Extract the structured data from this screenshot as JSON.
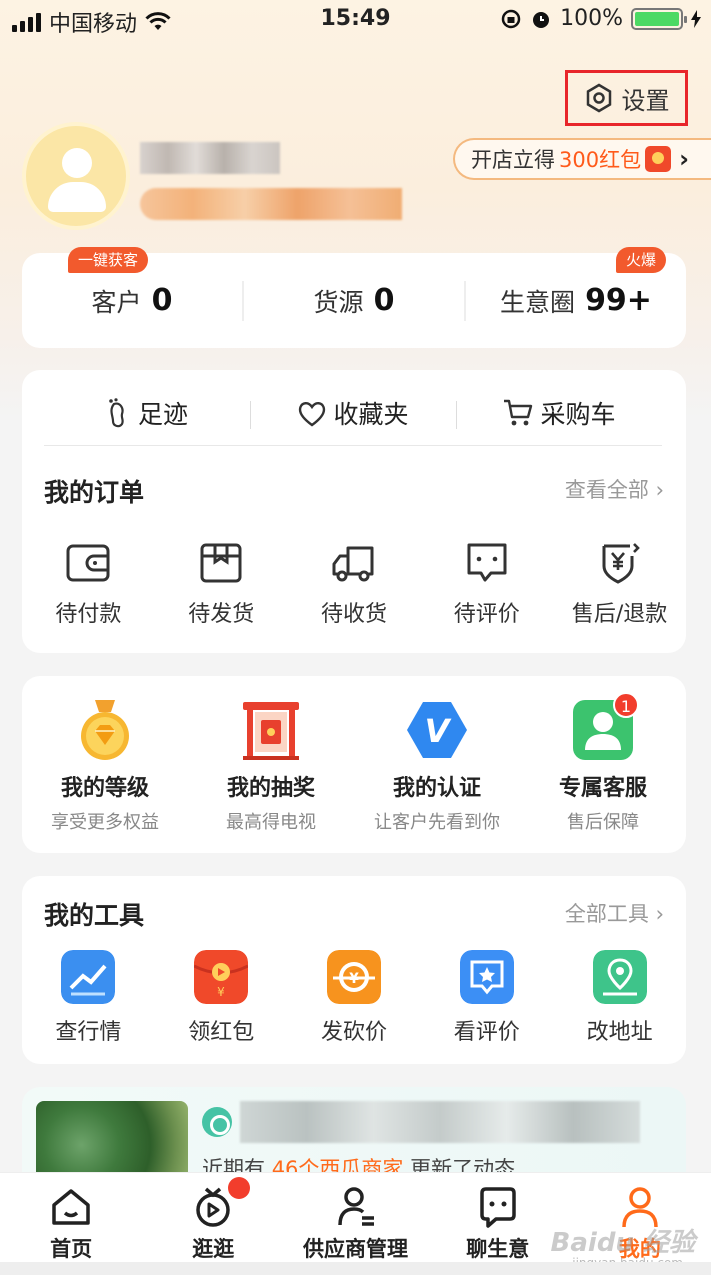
{
  "status_bar": {
    "carrier": "中国移动",
    "time": "15:49",
    "battery": "100%"
  },
  "header": {
    "settings_label": "设置",
    "promo": {
      "prefix": "开店立得",
      "amount": "300红包"
    }
  },
  "stats": [
    {
      "label": "客户",
      "value": "0",
      "tag": "一键获客"
    },
    {
      "label": "货源",
      "value": "0",
      "tag": ""
    },
    {
      "label": "生意圈",
      "value": "99+",
      "tag": "火爆"
    }
  ],
  "quick_links": [
    {
      "label": "足迹",
      "icon": "footprint-icon"
    },
    {
      "label": "收藏夹",
      "icon": "heart-icon"
    },
    {
      "label": "采购车",
      "icon": "cart-icon"
    }
  ],
  "orders": {
    "title": "我的订单",
    "more": "查看全部",
    "items": [
      {
        "label": "待付款",
        "icon": "wallet-icon"
      },
      {
        "label": "待发货",
        "icon": "package-icon"
      },
      {
        "label": "待收货",
        "icon": "truck-icon"
      },
      {
        "label": "待评价",
        "icon": "chat-icon"
      },
      {
        "label": "售后/退款",
        "icon": "refund-icon"
      }
    ]
  },
  "services": [
    {
      "title": "我的等级",
      "subtitle": "享受更多权益",
      "icon": "medal-icon"
    },
    {
      "title": "我的抽奖",
      "subtitle": "最高得电视",
      "icon": "lottery-icon"
    },
    {
      "title": "我的认证",
      "subtitle": "让客户先看到你",
      "icon": "verified-icon"
    },
    {
      "title": "专属客服",
      "subtitle": "售后保障",
      "icon": "service-icon",
      "badge": "1"
    }
  ],
  "tools": {
    "title": "我的工具",
    "more": "全部工具",
    "items": [
      {
        "label": "查行情",
        "icon": "trend-icon",
        "color": "#3b8ff0"
      },
      {
        "label": "领红包",
        "icon": "redpacket-icon",
        "color": "#f0492a"
      },
      {
        "label": "发砍价",
        "icon": "bargain-icon",
        "color": "#f7931e"
      },
      {
        "label": "看评价",
        "icon": "review-icon",
        "color": "#3c8ff5"
      },
      {
        "label": "改地址",
        "icon": "location-icon",
        "color": "#3ec48a"
      }
    ]
  },
  "feed": {
    "prefix": "近期有",
    "highlight": "46个西瓜商家",
    "suffix": "更新了动态"
  },
  "tabs": [
    {
      "label": "首页",
      "icon": "home-icon"
    },
    {
      "label": "逛逛",
      "icon": "tv-icon"
    },
    {
      "label": "供应商管理",
      "icon": "supplier-icon"
    },
    {
      "label": "聊生意",
      "icon": "chat-bubble-icon"
    },
    {
      "label": "我的",
      "icon": "user-icon"
    }
  ],
  "watermark": {
    "main": "Baidu 经验",
    "sub": "jingyan.baidu.com"
  }
}
